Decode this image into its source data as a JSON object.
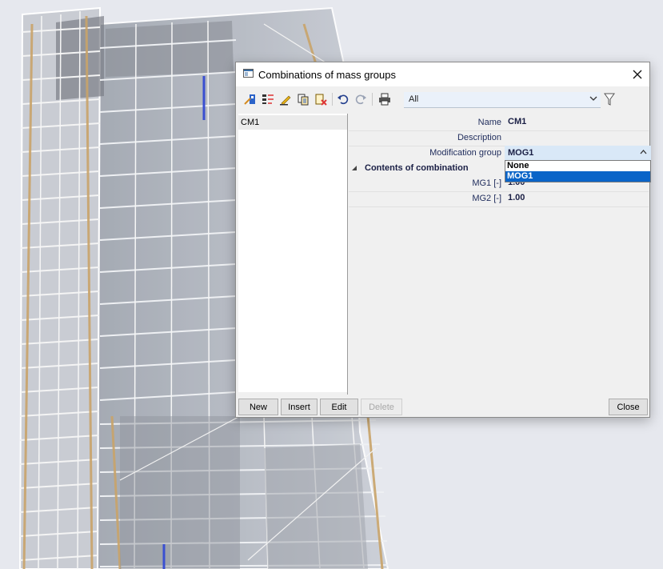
{
  "dialog": {
    "title": "Combinations of mass groups",
    "toolbar": {
      "filter_value": "All",
      "icons": [
        "pick-icon",
        "edit-properties-icon",
        "pencil-icon",
        "copy-icon",
        "delete-icon",
        "undo-icon",
        "redo-icon",
        "print-icon",
        "filter-funnel-icon"
      ]
    },
    "list": {
      "items": [
        {
          "label": "CM1"
        }
      ]
    },
    "properties": {
      "name": {
        "label": "Name",
        "value": "CM1"
      },
      "description": {
        "label": "Description",
        "value": ""
      },
      "modification_group": {
        "label": "Modification group",
        "value": "MOG1"
      },
      "contents_section": {
        "title": "Contents of combination"
      },
      "mg1": {
        "label": "MG1 [-]",
        "value": "1.00"
      },
      "mg2": {
        "label": "MG2 [-]",
        "value": "1.00"
      }
    },
    "dropdown": {
      "options": [
        {
          "label": "None",
          "selected": false
        },
        {
          "label": "MOG1",
          "selected": true
        }
      ]
    },
    "buttons": {
      "new": "New",
      "insert": "Insert",
      "edit": "Edit",
      "delete": "Delete",
      "close": "Close"
    }
  },
  "colors": {
    "selection": "#0a64c8",
    "field_highlight": "#d9e8f7",
    "label_text": "#1f2c5c"
  }
}
